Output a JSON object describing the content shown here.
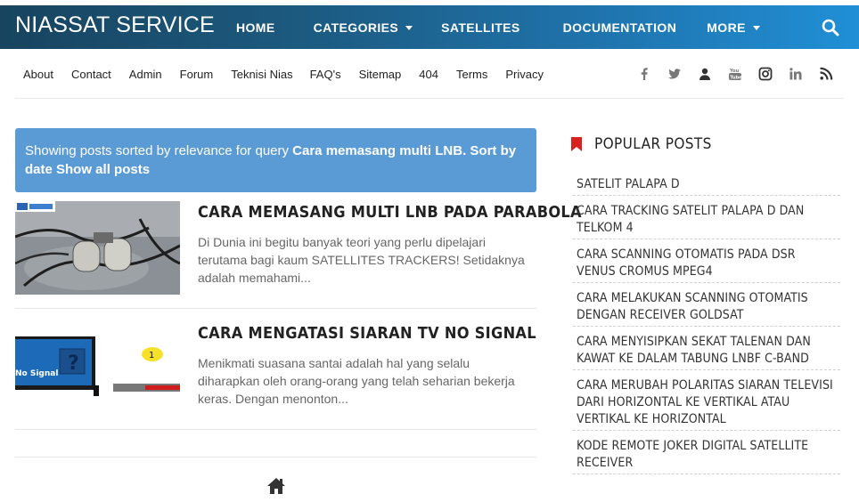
{
  "brand": "NIASSAT SERVICE",
  "nav": {
    "items": [
      {
        "label": "HOME",
        "dropdown": false
      },
      {
        "label": "CATEGORIES",
        "dropdown": true
      },
      {
        "label": "SATELLITES",
        "dropdown": false
      },
      {
        "label": "DOCUMENTATION",
        "dropdown": false
      },
      {
        "label": "MORE",
        "dropdown": true
      }
    ],
    "search_icon": "search-icon"
  },
  "subnav": {
    "links": [
      "About",
      "Contact",
      "Admin",
      "Forum",
      "Teknisi Nias",
      "FAQ's",
      "Sitemap",
      "404",
      "Terms",
      "Privacy"
    ],
    "social": [
      "facebook-icon",
      "twitter-icon",
      "user-icon",
      "youtube-icon",
      "instagram-icon",
      "linkedin-icon",
      "rss-icon"
    ]
  },
  "status": {
    "prefix": "Showing posts sorted by relevance for query ",
    "query": "Cara memasang multi LNB",
    "sep": ". ",
    "sort_label": "Sort by date",
    "show_all_label": "Show all posts"
  },
  "posts": [
    {
      "title": "CARA MEMASANG MULTI LNB PADA PARABOLA",
      "snippet": "Di Dunia ini begitu banyak teori yang perlu dipelajari terutama bagi kaum SATELLITES TRACKERS! Setidaknya adalah memahami..."
    },
    {
      "title": "CARA MENGATASI SIARAN TV NO SIGNAL",
      "snippet": "Menikmati suasana santai adalah hal yang selalu diharapkan oleh orang-orang yang telah seharian bekerja keras. Dengan menonton...",
      "thumb_text": "No Signal",
      "thumb_badge": "1"
    }
  ],
  "sidebar": {
    "popular_title": "POPULAR POSTS",
    "items": [
      "SATELIT PALAPA D",
      "CARA TRACKING SATELIT PALAPA D DAN TELKOM 4",
      "CARA SCANNING OTOMATIS PADA DSR VENUS CROMUS MPEG4",
      "CARA MELAKUKAN SCANNING OTOMATIS DENGAN RECEIVER GOLDSAT",
      "CARA MENYISIPKAN SEKAT TALENAN DAN KAWAT KE DALAM TABUNG LNBF C-BAND",
      "CARA MERUBAH POLARITAS SIARAN TELEVISI DARI HORIZONTAL KE VERTIKAL ATAU VERTIKAL KE HORIZONTAL",
      "KODE REMOTE JOKER DIGITAL SATELLITE RECEIVER"
    ]
  },
  "footer": {
    "home_icon": "home-icon"
  },
  "colors": {
    "header_dark": "#18445f",
    "header_light": "#208fd6",
    "status_bg": "#5b9bd5",
    "bookmark_red": "#d9211f",
    "social_gray": "#777777"
  }
}
